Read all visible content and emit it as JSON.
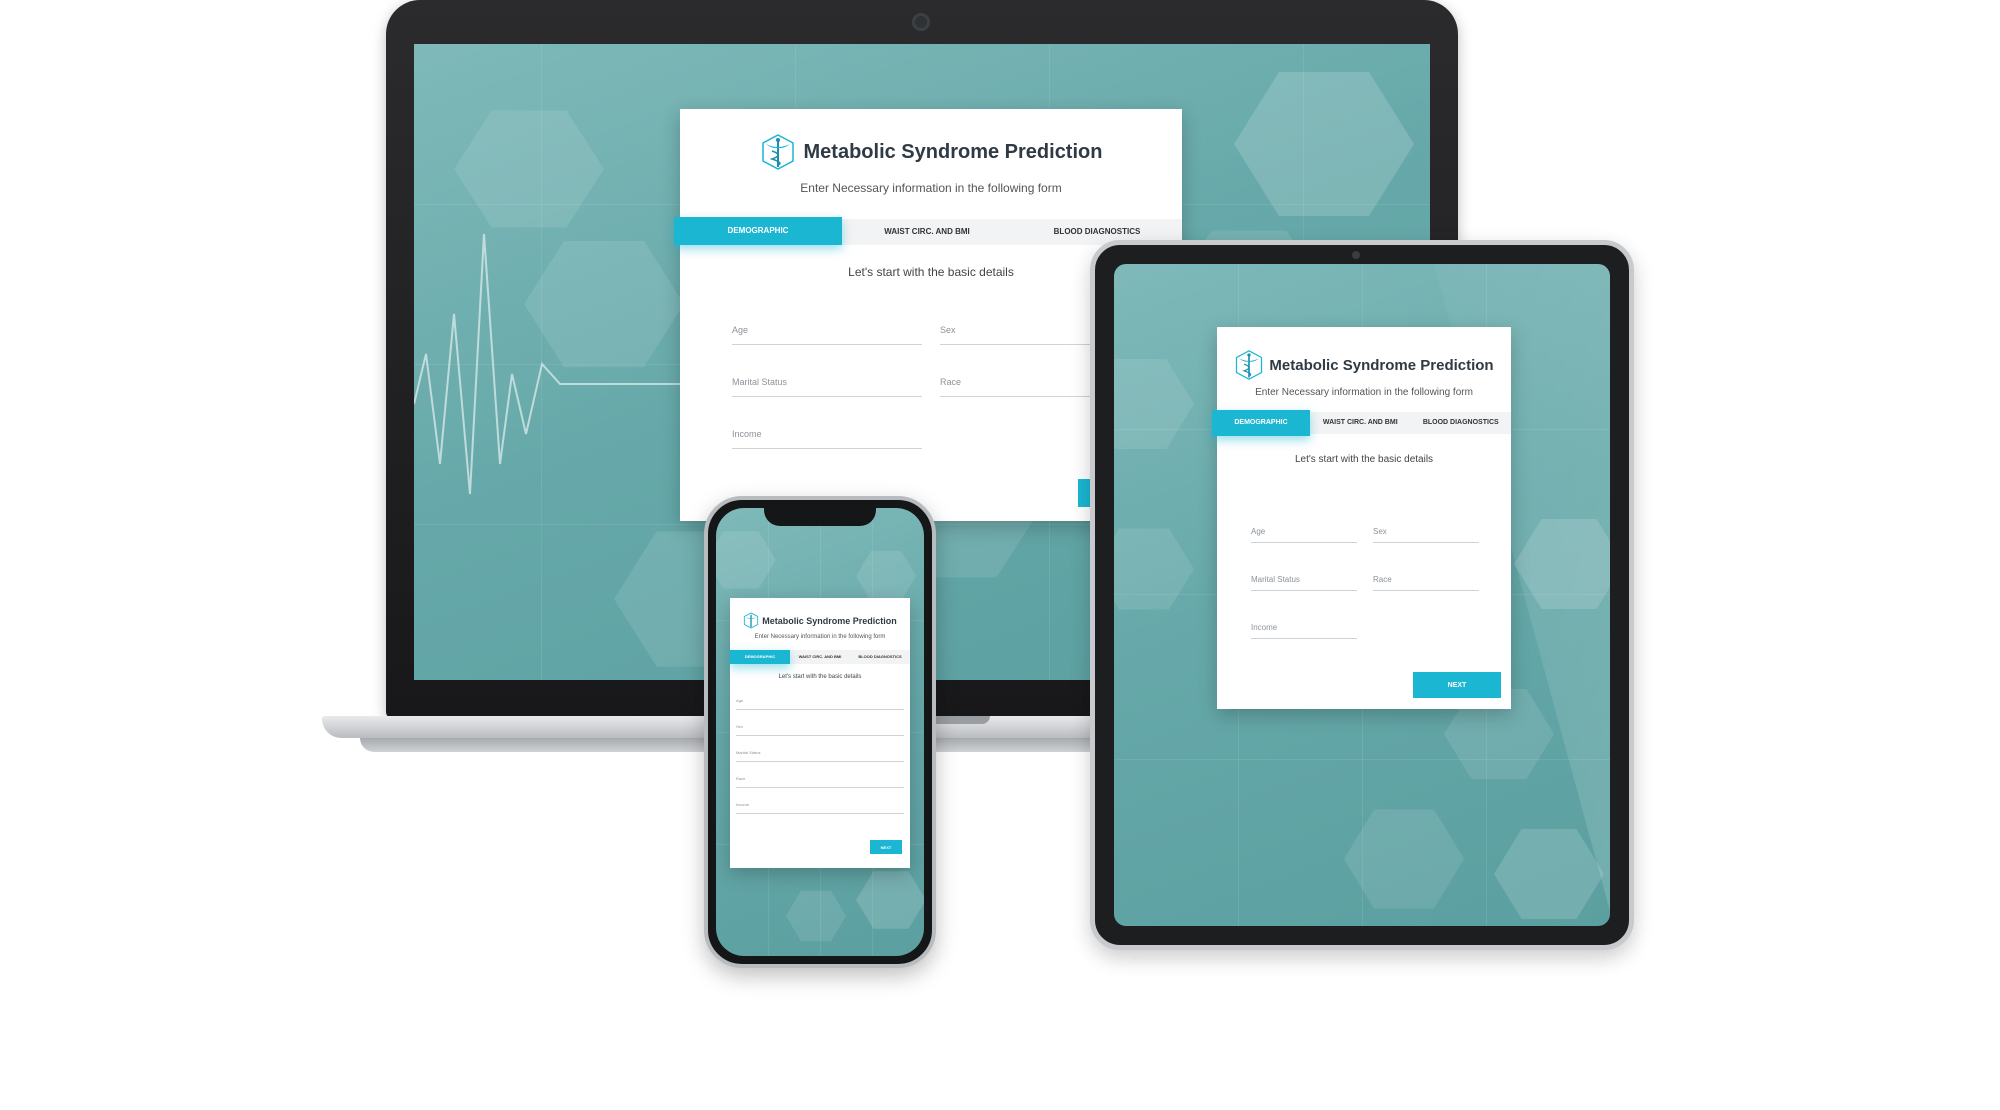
{
  "app": {
    "title": "Metabolic Syndrome Prediction",
    "subtitle": "Enter Necessary information in the following form",
    "accent_color": "#1bb6d2",
    "logo_icon": "caduceus-icon"
  },
  "tabs": [
    {
      "label": "DEMOGRAPHIC",
      "active": true
    },
    {
      "label": "WAIST CIRC. AND BMI",
      "active": false
    },
    {
      "label": "BLOOD DIAGNOSTICS",
      "active": false
    }
  ],
  "section_title": "Let's start with the basic details",
  "fields": {
    "age": "Age",
    "sex": "Sex",
    "marital_status": "Marital Status",
    "race": "Race",
    "income": "Income"
  },
  "next_button": "NEXT"
}
